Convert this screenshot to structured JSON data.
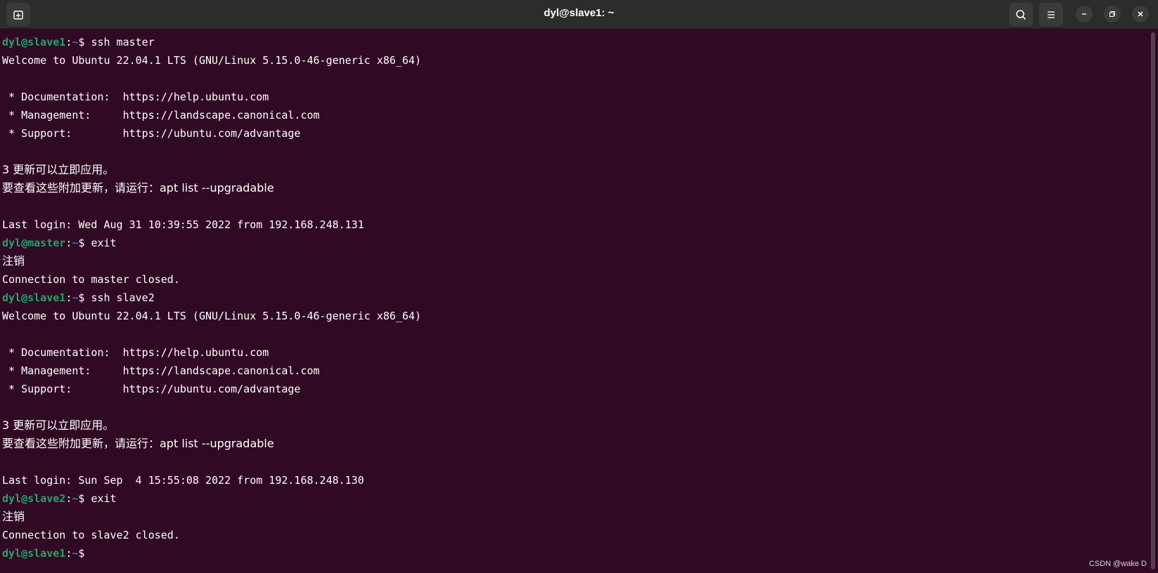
{
  "window": {
    "title": "dyl@slave1: ~",
    "icons": {
      "new_tab": "new-tab-icon",
      "search": "search-icon",
      "menu": "hamburger-menu-icon",
      "minimize": "minimize-icon",
      "maximize": "maximize-icon",
      "close": "close-icon"
    }
  },
  "colors": {
    "background": "#300a24",
    "prompt_user": "#26a269",
    "prompt_path": "#3a73c0",
    "text": "#ffffff"
  },
  "terminal": {
    "lines": [
      {
        "type": "prompt",
        "user": "dyl@slave1",
        "sep": ":",
        "path": "~",
        "sym": "$ ",
        "cmd": "ssh master"
      },
      {
        "type": "text",
        "text": "Welcome to Ubuntu 22.04.1 LTS (GNU/Linux 5.15.0-46-generic x86_64)"
      },
      {
        "type": "text",
        "text": ""
      },
      {
        "type": "text",
        "text": " * Documentation:  https://help.ubuntu.com"
      },
      {
        "type": "text",
        "text": " * Management:     https://landscape.canonical.com"
      },
      {
        "type": "text",
        "text": " * Support:        https://ubuntu.com/advantage"
      },
      {
        "type": "text",
        "text": ""
      },
      {
        "type": "text",
        "text": "3 更新可以立即应用。",
        "cjk": true
      },
      {
        "type": "text",
        "text": "要查看这些附加更新，请运行：apt list --upgradable",
        "cjk": true
      },
      {
        "type": "text",
        "text": ""
      },
      {
        "type": "text",
        "text": "Last login: Wed Aug 31 10:39:55 2022 from 192.168.248.131"
      },
      {
        "type": "prompt",
        "user": "dyl@master",
        "sep": ":",
        "path": "~",
        "sym": "$ ",
        "cmd": "exit"
      },
      {
        "type": "text",
        "text": "注销",
        "cjk": true
      },
      {
        "type": "text",
        "text": "Connection to master closed."
      },
      {
        "type": "prompt",
        "user": "dyl@slave1",
        "sep": ":",
        "path": "~",
        "sym": "$ ",
        "cmd": "ssh slave2"
      },
      {
        "type": "text",
        "text": "Welcome to Ubuntu 22.04.1 LTS (GNU/Linux 5.15.0-46-generic x86_64)"
      },
      {
        "type": "text",
        "text": ""
      },
      {
        "type": "text",
        "text": " * Documentation:  https://help.ubuntu.com"
      },
      {
        "type": "text",
        "text": " * Management:     https://landscape.canonical.com"
      },
      {
        "type": "text",
        "text": " * Support:        https://ubuntu.com/advantage"
      },
      {
        "type": "text",
        "text": ""
      },
      {
        "type": "text",
        "text": "3 更新可以立即应用。",
        "cjk": true
      },
      {
        "type": "text",
        "text": "要查看这些附加更新，请运行：apt list --upgradable",
        "cjk": true
      },
      {
        "type": "text",
        "text": ""
      },
      {
        "type": "text",
        "text": "Last login: Sun Sep  4 15:55:08 2022 from 192.168.248.130"
      },
      {
        "type": "prompt",
        "user": "dyl@slave2",
        "sep": ":",
        "path": "~",
        "sym": "$ ",
        "cmd": "exit"
      },
      {
        "type": "text",
        "text": "注销",
        "cjk": true
      },
      {
        "type": "text",
        "text": "Connection to slave2 closed."
      },
      {
        "type": "prompt",
        "user": "dyl@slave1",
        "sep": ":",
        "path": "~",
        "sym": "$ ",
        "cmd": ""
      }
    ]
  },
  "watermark": "CSDN @wake D"
}
